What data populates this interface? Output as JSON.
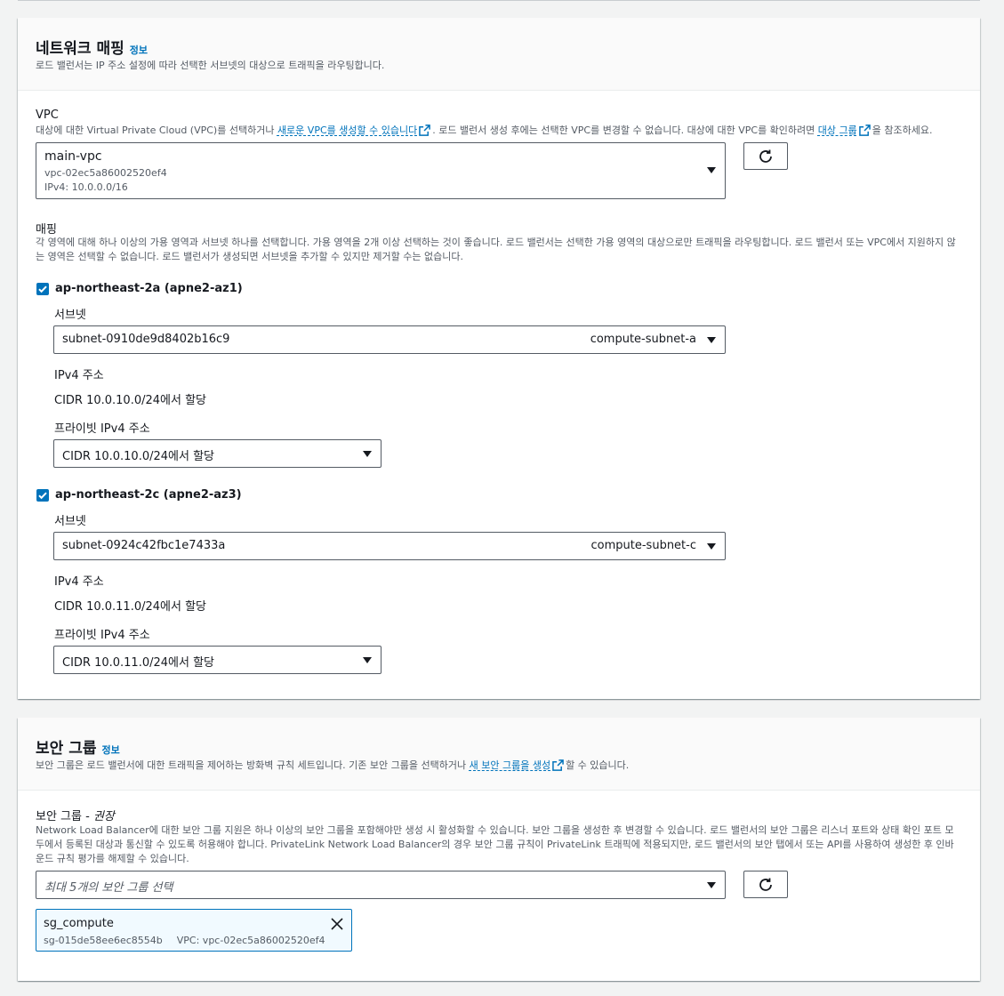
{
  "network": {
    "title": "네트워크 매핑",
    "info": "정보",
    "description": "로드 밸런서는 IP 주소 설정에 따라 선택한 서브넷의 대상으로 트래픽을 라우팅합니다.",
    "vpc": {
      "label": "VPC",
      "desc_before": "대상에 대한 Virtual Private Cloud (VPC)를 선택하거나 ",
      "desc_link1": "새로운 VPC를 생성할 수 있습니다",
      "desc_middle": ". 로드 밸런서 생성 후에는 선택한 VPC를 변경할 수 없습니다. 대상에 대한 VPC를 확인하려면 ",
      "desc_link2": "대상 그룹",
      "desc_after": "을 참조하세요.",
      "selected_name": "main-vpc",
      "selected_id": "vpc-02ec5a86002520ef4",
      "selected_cidr": "IPv4: 10.0.0.0/16"
    },
    "mapping": {
      "label": "매핑",
      "description": "각 영역에 대해 하나 이상의 가용 영역과 서브넷 하나를 선택합니다. 가용 영역을 2개 이상 선택하는 것이 좋습니다. 로드 밸런서는 선택한 가용 영역의 대상으로만 트래픽을 라우팅합니다. 로드 밸런서 또는 VPC에서 지원하지 않는 영역은 선택할 수 없습니다. 로드 밸런서가 생성되면 서브넷을 추가할 수 있지만 제거할 수는 없습니다.",
      "zones": [
        {
          "name": "ap-northeast-2a (apne2-az1)",
          "subnet_label": "서브넷",
          "subnet_id": "subnet-0910de9d8402b16c9",
          "subnet_name": "compute-subnet-a",
          "ipv4_label": "IPv4 주소",
          "ipv4_value": "CIDR 10.0.10.0/24에서 할당",
          "private_label": "프라이빗 IPv4 주소",
          "private_value": "CIDR 10.0.10.0/24에서 할당"
        },
        {
          "name": "ap-northeast-2c (apne2-az3)",
          "subnet_label": "서브넷",
          "subnet_id": "subnet-0924c42fbc1e7433a",
          "subnet_name": "compute-subnet-c",
          "ipv4_label": "IPv4 주소",
          "ipv4_value": "CIDR 10.0.11.0/24에서 할당",
          "private_label": "프라이빗 IPv4 주소",
          "private_value": "CIDR 10.0.11.0/24에서 할당"
        }
      ]
    }
  },
  "security": {
    "title": "보안 그룹",
    "info": "정보",
    "desc_before": "보안 그룹은 로드 밸런서에 대한 트래픽을 제어하는 방화벽 규칙 세트입니다. 기존 보안 그룹을 선택하거나 ",
    "desc_link": "새 보안 그룹을 생성",
    "desc_after": "할 수 있습니다.",
    "field_label": "보안 그룹 - ",
    "field_label_em": "권장",
    "field_desc": "Network Load Balancer에 대한 보안 그룹 지원은 하나 이상의 보안 그룹을 포함해야만 생성 시 활성화할 수 있습니다. 보안 그룹을 생성한 후 변경할 수 있습니다. 로드 밸런서의 보안 그룹은 리스너 포트와 상태 확인 포트 모두에서 등록된 대상과 통신할 수 있도록 허용해야 합니다. PrivateLink Network Load Balancer의 경우 보안 그룹 규칙이 PrivateLink 트래픽에 적용되지만, 로드 밸런서의 보안 탭에서 또는 API를 사용하여 생성한 후 인바운드 규칙 평가를 해제할 수 있습니다.",
    "placeholder": "최대 5개의 보안 그룹 선택",
    "token": {
      "name": "sg_compute",
      "id": "sg-015de58ee6ec8554b",
      "vpc": "VPC: vpc-02ec5a86002520ef4"
    }
  },
  "colors": {
    "accent": "#0073bb",
    "text": "#16191f",
    "muted": "#545b64",
    "background": "#f2f3f3"
  },
  "icons": {
    "refresh": "refresh-icon",
    "external": "external-link-icon",
    "checkbox": "checkmark-icon",
    "caret": "caret-down-icon",
    "close": "close-icon"
  }
}
